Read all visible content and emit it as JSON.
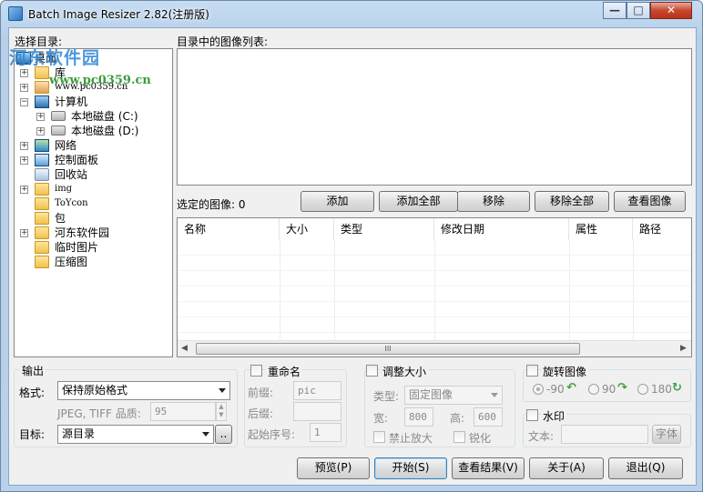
{
  "window": {
    "title": "Batch Image Resizer 2.82(注册版)",
    "min_label": "—",
    "max_label": "□",
    "close_label": "✕"
  },
  "watermark": {
    "site_name": "河东软件园",
    "url": "www.pc0359.cn"
  },
  "tree": {
    "label": "选择目录:",
    "items": [
      {
        "label": "桌面",
        "icon": "desktop-icon"
      },
      {
        "label": "库",
        "icon": "library-icon"
      },
      {
        "label": "www.pc0359.cn",
        "icon": "user-icon"
      },
      {
        "label": "计算机",
        "icon": "computer-icon"
      },
      {
        "label": "本地磁盘 (C:)",
        "icon": "drive-icon"
      },
      {
        "label": "本地磁盘 (D:)",
        "icon": "drive-icon"
      },
      {
        "label": "网络",
        "icon": "network-icon"
      },
      {
        "label": "控制面板",
        "icon": "control-panel-icon"
      },
      {
        "label": "回收站",
        "icon": "recycle-bin-icon"
      },
      {
        "label": "img",
        "icon": "folder-icon"
      },
      {
        "label": "ToYcon",
        "icon": "folder-icon"
      },
      {
        "label": "包",
        "icon": "folder-icon"
      },
      {
        "label": "河东软件园",
        "icon": "folder-icon"
      },
      {
        "label": "临时图片",
        "icon": "folder-icon"
      },
      {
        "label": "压缩图",
        "icon": "folder-icon"
      }
    ]
  },
  "image_list": {
    "label": "目录中的图像列表:"
  },
  "selected": {
    "label": "选定的图像: 0",
    "buttons": {
      "add": "添加",
      "add_all": "添加全部",
      "remove": "移除",
      "remove_all": "移除全部",
      "view": "查看图像"
    },
    "columns": [
      "名称",
      "大小",
      "类型",
      "修改日期",
      "属性",
      "路径"
    ],
    "scrollbar_thumb": "III"
  },
  "output": {
    "title": "输出",
    "format_label": "格式:",
    "format_value": "保持原始格式",
    "quality_label": "JPEG, TIFF 品质:",
    "quality_value": "95",
    "target_label": "目标:",
    "target_value": "源目录",
    "browse_label": ".."
  },
  "rename": {
    "title": "重命名",
    "prefix_label": "前缀:",
    "prefix_value": "pic",
    "suffix_label": "后缀:",
    "suffix_value": "",
    "start_label": "起始序号:",
    "start_value": "1"
  },
  "resize": {
    "title": "调整大小",
    "type_label": "类型:",
    "type_value": "固定图像",
    "width_label": "宽:",
    "width_value": "800",
    "height_label": "高:",
    "height_value": "600",
    "no_enlarge_label": "禁止放大",
    "sharpen_label": "锐化"
  },
  "rotate": {
    "title": "旋转图像",
    "options": [
      "-90",
      "90",
      "180"
    ]
  },
  "watermark_group": {
    "title": "水印",
    "text_label": "文本:",
    "text_value": "",
    "font_button": "字体"
  },
  "actions": {
    "preview": "预览(P)",
    "start": "开始(S)",
    "view_result": "查看结果(V)",
    "about": "关于(A)",
    "exit": "退出(Q)"
  }
}
